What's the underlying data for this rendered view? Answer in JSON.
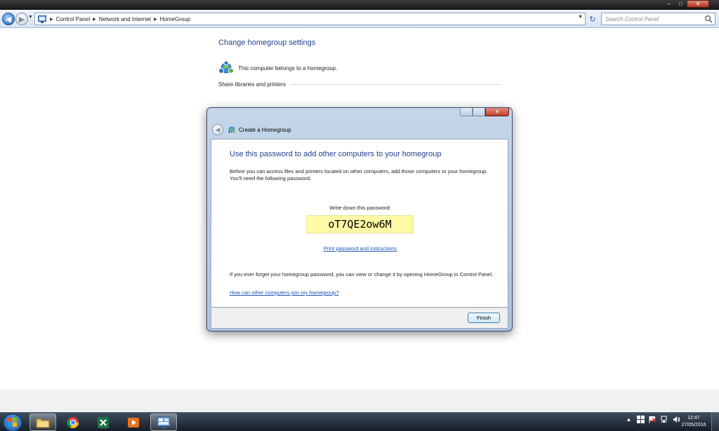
{
  "window": {
    "minimize_glyph": "–",
    "maximize_glyph": "□",
    "close_glyph": "✕"
  },
  "navigation": {
    "breadcrumbs": [
      "Control Panel",
      "Network and Internet",
      "HomeGroup"
    ],
    "search_placeholder": "Search Control Panel"
  },
  "content": {
    "title": "Change homegroup settings",
    "status_text": "This computer belongs to a homegroup.",
    "share_heading": "Share libraries and printers"
  },
  "dialog": {
    "title": "Create a Homegroup",
    "heading": "Use this password to add other computers to your homegroup",
    "intro": "Before you can access files and printers located on other computers, add those computers to your homegroup. You'll need the following password.",
    "password_label": "Write down this password:",
    "password": "oT7QE2ow6M",
    "print_link": "Print password and instructions",
    "forget_text": "If you ever forget your homegroup password, you can view or change it by opening HomeGroup in Control Panel.",
    "join_link": "How can other computers join my homegroup?",
    "finish_label": "Finish"
  },
  "taskbar": {
    "apps": [
      "file-explorer",
      "chrome",
      "excel",
      "media-player",
      "control-panel"
    ],
    "active_app": "control-panel",
    "clock_time": "12:47",
    "clock_date": "27/05/2016"
  },
  "colors": {
    "link": "#1a55b5",
    "heading": "#1e3f8a",
    "password_highlight": "#fffaa5"
  }
}
